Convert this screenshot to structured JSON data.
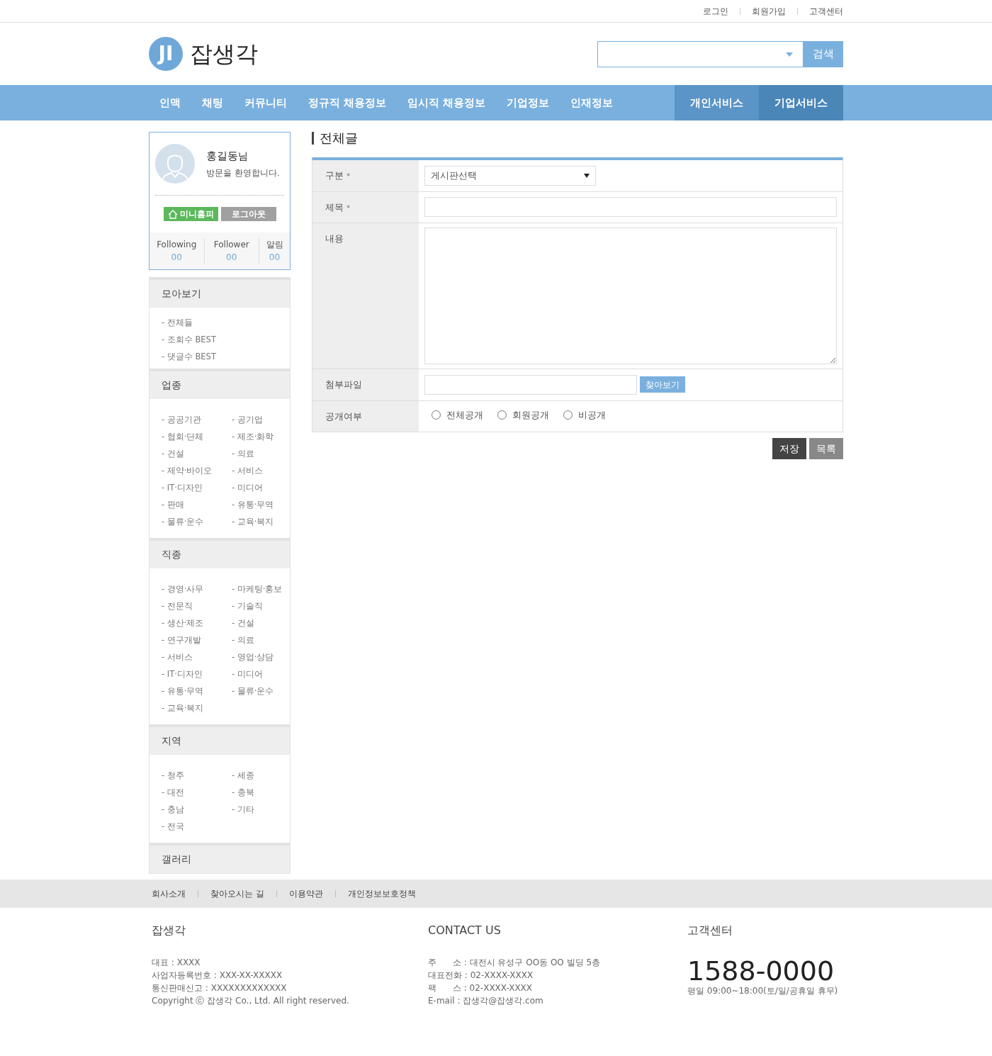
{
  "top_links": [
    "로그인",
    "회원가입",
    "고객센터"
  ],
  "logo": {
    "mark": "JI",
    "name": "잡생각"
  },
  "search": {
    "button": "검색"
  },
  "nav": [
    {
      "label": "인맥",
      "kind": "menu"
    },
    {
      "label": "채팅",
      "kind": "menu"
    },
    {
      "label": "커뮤니티",
      "kind": "menu"
    },
    {
      "label": "정규직 채용정보",
      "kind": "menu"
    },
    {
      "label": "임시직 채용정보",
      "kind": "menu"
    },
    {
      "label": "기업정보",
      "kind": "menu"
    },
    {
      "label": "인재정보",
      "kind": "menu"
    },
    {
      "label": "개인서비스",
      "kind": "personal"
    },
    {
      "label": "기업서비스",
      "kind": "business"
    }
  ],
  "profile": {
    "name": "홍길동",
    "suffix": "님",
    "greeting": "방문을 환영합니다.",
    "buttons": [
      "미니홈피",
      "로그아웃"
    ],
    "stats": [
      {
        "label": "Following",
        "value": "00"
      },
      {
        "label": "Follower",
        "value": "00"
      },
      {
        "label": "알림",
        "value": "00"
      }
    ]
  },
  "sidebar": [
    {
      "title": "모아보기",
      "kind": "list",
      "items": [
        "- 전체들",
        "- 조회수 BEST",
        "- 댓글수 BEST"
      ]
    },
    {
      "title": "업종",
      "kind": "grid",
      "items": [
        "- 공공기관",
        "- 공기업",
        "- 협회·단체",
        "- 제조·화학",
        "- 건설",
        "- 의료",
        "- 제약·바이오",
        "- 서비스",
        "- IT·디자인",
        "- 미디어",
        "- 판매",
        "- 유통·무역",
        "- 물류·운수",
        "- 교육·복지"
      ]
    },
    {
      "title": "직종",
      "kind": "grid",
      "items": [
        "- 경영·사무",
        "- 마케팅·홍보",
        "- 전문직",
        "- 기술직",
        "- 생산·제조",
        "- 건설",
        "- 연구개발",
        "- 의료",
        "- 서비스",
        "- 영업·상담",
        "- IT·디자인",
        "- 미디어",
        "- 유통·무역",
        "- 물류·운수",
        "- 교육·복지"
      ]
    },
    {
      "title": "지역",
      "kind": "grid",
      "items": [
        "- 청주",
        "- 세종",
        "- 대전",
        "- 충북",
        "- 충남",
        "- 기타",
        "- 전국"
      ]
    },
    {
      "title": "갤러리",
      "kind": "heading"
    }
  ],
  "page_title": "전체글",
  "form": [
    {
      "label": "구분",
      "required_mark": "*",
      "kind": "select",
      "value": "게시판선택"
    },
    {
      "label": "제목",
      "required_mark": "*",
      "kind": "text"
    },
    {
      "label": "내용",
      "kind": "textarea"
    },
    {
      "label": "첨부파일",
      "kind": "file",
      "button": "찾아보기"
    },
    {
      "label": "공개여부",
      "kind": "radio",
      "options": [
        {
          "label": "전체공개",
          "checked": false
        },
        {
          "label": "회원공개",
          "checked": false
        },
        {
          "label": "비공개",
          "checked": false
        }
      ]
    }
  ],
  "form_buttons": [
    {
      "label": "저장",
      "kind": "primary"
    },
    {
      "label": "목록",
      "kind": "secondary"
    }
  ],
  "footer_links": [
    "회사소개",
    "찾아오시는 길",
    "이용약관",
    "개인정보보호정책"
  ],
  "footer": {
    "company": {
      "title": "잡생각",
      "lines": [
        "대표 : XXXX",
        "사업자등록번호 : XXX-XX-XXXXX",
        "통신판매신고 : XXXXXXXXXXXXX",
        "Copyright ⓒ 잡생각 Co., Ltd. All right reserved."
      ]
    },
    "contact": {
      "title": "CONTACT US",
      "lines": [
        "주      소 : 대전시 유성구 OO동 OO 빌딩 5층",
        "대표전화 : 02-XXXX-XXXX",
        "팩      스 : 02-XXXX-XXXX",
        "E-mail : 잡생각@잡생각.com"
      ]
    },
    "service": {
      "title": "고객센터",
      "phone": "1588-0000",
      "hours": "평일 09:00~18:00(토/일/공휴일 휴무)"
    }
  }
}
